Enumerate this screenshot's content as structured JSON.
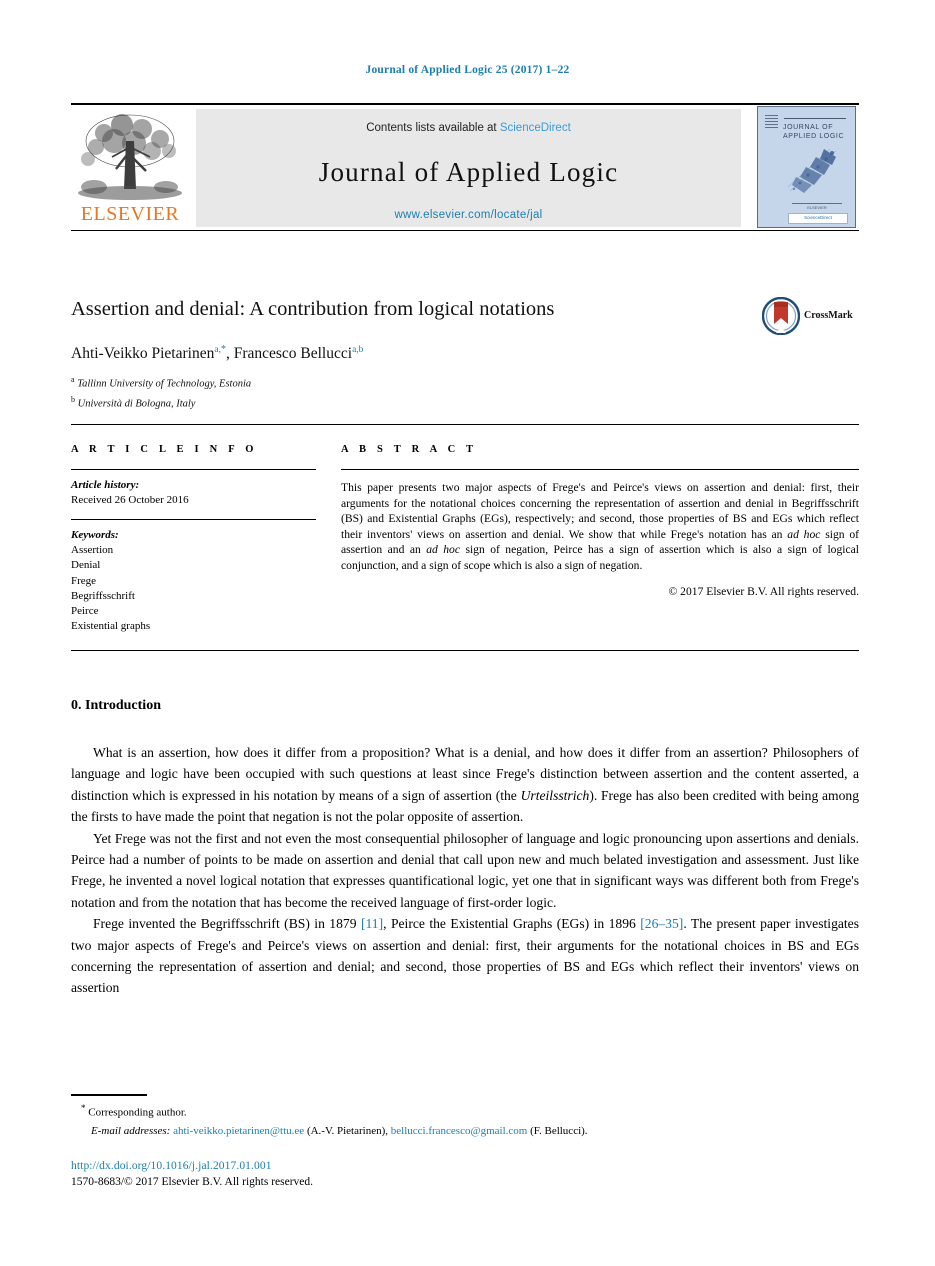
{
  "running_head": "Journal of Applied Logic 25 (2017) 1–22",
  "masthead": {
    "contents_prefix": "Contents lists available at ",
    "sciencedirect": "ScienceDirect",
    "journal_title": "Journal of Applied Logic",
    "journal_url": "www.elsevier.com/locate/jal",
    "publisher_wordmark": "ELSEVIER",
    "cover": {
      "title_line1": "JOURNAL OF",
      "title_line2": "APPLIED LOGIC",
      "footer_text": "ELSEVIER",
      "badge_text": "ScienceDirect"
    }
  },
  "article": {
    "title": "Assertion and denial: A contribution from logical notations",
    "authors": [
      {
        "name": "Ahti-Veikko Pietarinen",
        "marks": "a,",
        "star": "*"
      },
      {
        "name": "Francesco Bellucci",
        "marks": "a,b",
        "star": ""
      }
    ],
    "author_line_separator": ", ",
    "affiliations": [
      {
        "mark": "a",
        "text": "Tallinn University of Technology, Estonia"
      },
      {
        "mark": "b",
        "text": "Università di Bologna, Italy"
      }
    ],
    "crossmark_label": "CrossMark"
  },
  "info": {
    "heading": "A R T I C L E   I N F O",
    "history_label": "Article history:",
    "history_value": "Received 26 October 2016",
    "keywords_label": "Keywords:",
    "keywords": [
      "Assertion",
      "Denial",
      "Frege",
      "Begriffsschrift",
      "Peirce",
      "Existential graphs"
    ]
  },
  "abstract": {
    "heading": "A B S T R A C T",
    "text_part1": "This paper presents two major aspects of Frege's and Peirce's views on assertion and denial: first, their arguments for the notational choices concerning the representation of assertion and denial in Begriffsschrift (BS) and Existential Graphs (EGs), respectively; and second, those properties of BS and EGs which reflect their inventors' views on assertion and denial. We show that while Frege's notation has an ",
    "italic1": "ad hoc",
    "text_part2": " sign of assertion and an ",
    "italic2": "ad hoc",
    "text_part3": " sign of negation, Peirce has a sign of assertion which is also a sign of logical conjunction, and a sign of scope which is also a sign of negation.",
    "copyright": "© 2017 Elsevier B.V. All rights reserved."
  },
  "body": {
    "section_heading": "0. Introduction",
    "paragraph1_a": "What is an assertion, how does it differ from a proposition? What is a denial, and how does it differ from an assertion? Philosophers of language and logic have been occupied with such questions at least since Frege's distinction between assertion and the content asserted, a distinction which is expressed in his notation by means of a sign of assertion (the ",
    "paragraph1_italic": "Urteilsstrich",
    "paragraph1_b": "). Frege has also been credited with being among the firsts to have made the point that negation is not the polar opposite of assertion.",
    "paragraph2": "Yet Frege was not the first and not even the most consequential philosopher of language and logic pronouncing upon assertions and denials. Peirce had a number of points to be made on assertion and denial that call upon new and much belated investigation and assessment. Just like Frege, he invented a novel logical notation that expresses quantificational logic, yet one that in significant ways was different both from Frege's notation and from the notation that has become the received language of first-order logic.",
    "paragraph3_a": "Frege invented the Begriffsschrift (BS) in 1879 ",
    "paragraph3_cite1": "[11]",
    "paragraph3_b": ", Peirce the Existential Graphs (EGs) in 1896 ",
    "paragraph3_cite2": "[26–35]",
    "paragraph3_c": ". The present paper investigates two major aspects of Frege's and Peirce's views on assertion and denial: first, their arguments for the notational choices in BS and EGs concerning the representation of assertion and denial; and second, those properties of BS and EGs which reflect their inventors' views on assertion"
  },
  "footer": {
    "corresponding_mark": "*",
    "corresponding_text": " Corresponding author.",
    "email_label": "E-mail addresses:",
    "email1": "ahti-veikko.pietarinen@ttu.ee",
    "email1_owner": " (A.-V. Pietarinen), ",
    "email2": "bellucci.francesco@gmail.com",
    "email2_owner": " (F. Bellucci).",
    "doi": "http://dx.doi.org/10.1016/j.jal.2017.01.001",
    "issn": "1570-8683/© 2017 Elsevier B.V. All rights reserved."
  },
  "colors": {
    "link_blue": "#1b7eb0",
    "sciencedirect_blue": "#3b9ad9",
    "elsevier_orange": "#e87722",
    "cover_blue": "#c5d6ea"
  }
}
